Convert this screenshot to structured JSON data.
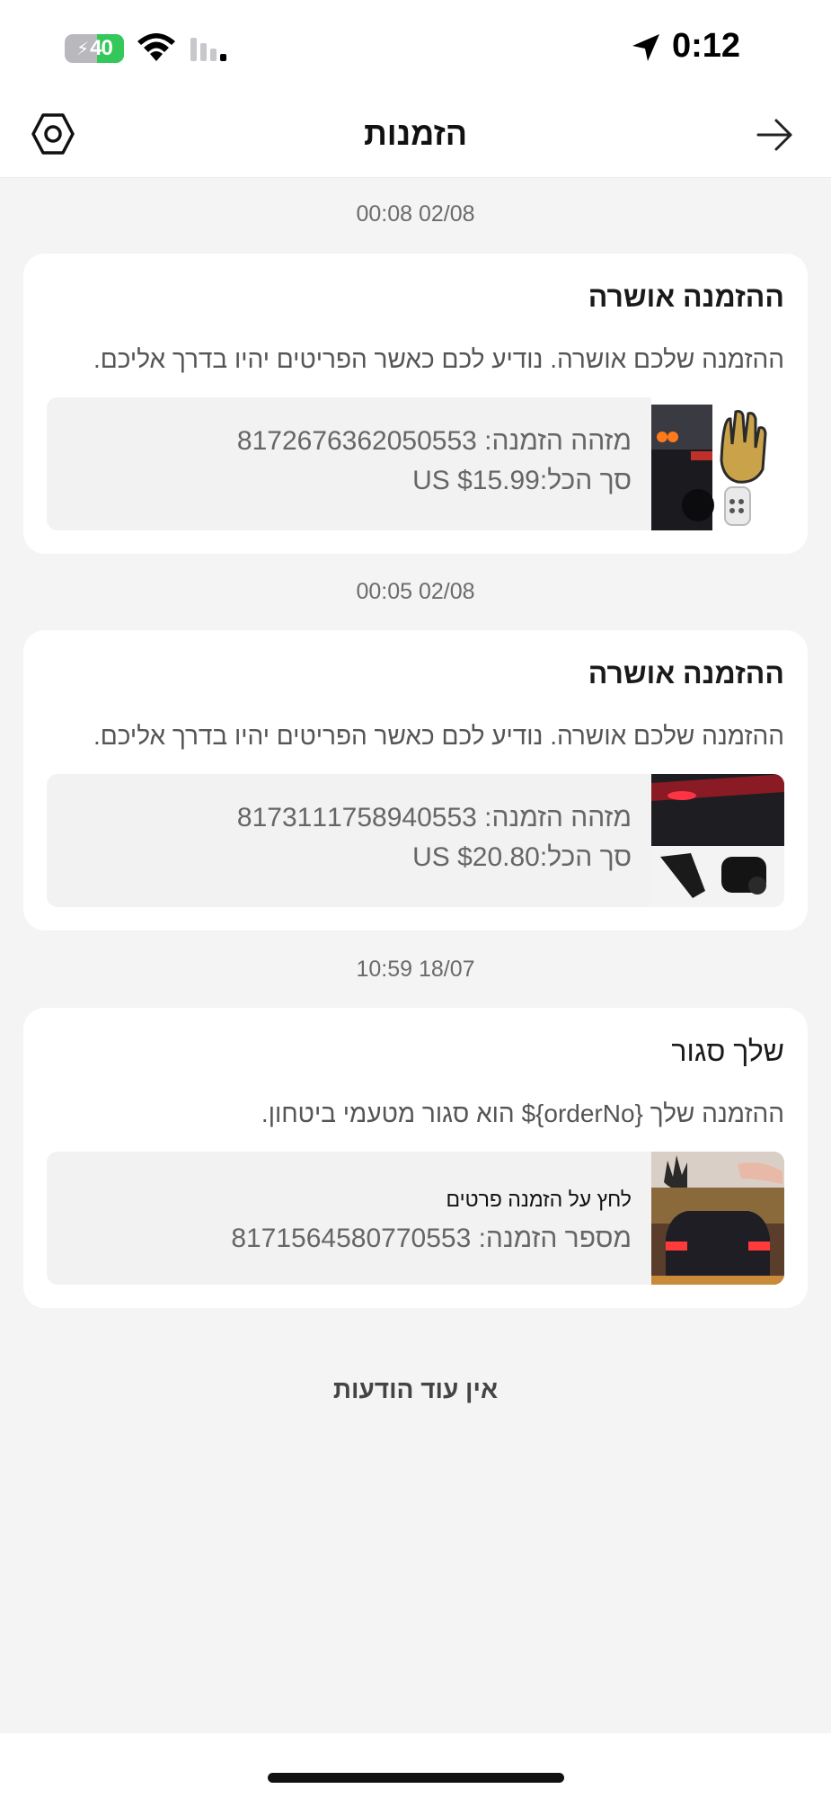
{
  "status_bar": {
    "battery": "40",
    "time": "0:12"
  },
  "header": {
    "title": "הזמנות",
    "settings_icon": "gear-icon",
    "back_icon": "arrow-right-icon"
  },
  "notifications": [
    {
      "timestamp": "00:08 02/08",
      "title": "ההזמנה אושרה",
      "description": "ההזמנה שלכם אושרה. נודיע לכם כאשר הפריטים יהיו בדרך אליכם.",
      "line1": "מזהה הזמנה: 8172676362050553",
      "line2": "סך הכל:US $15.99"
    },
    {
      "timestamp": "00:05 02/08",
      "title": "ההזמנה אושרה",
      "description": "ההזמנה שלכם אושרה. נודיע לכם כאשר הפריטים יהיו בדרך אליכם.",
      "line1": "מזהה הזמנה: 8173111758940553",
      "line2": "סך הכל:US $20.80"
    },
    {
      "timestamp": "10:59 18/07",
      "title": "שלך סגור",
      "description": "ההזמנה שלך {orderNo}$ הוא סגור מטעמי ביטחון.",
      "hint": "לחץ על הזמנה פרטים",
      "line2": "מספר הזמנה: 8171564580770553"
    }
  ],
  "footer_text": "אין עוד הודעות",
  "colors": {
    "background": "#f4f4f5",
    "card": "#ffffff",
    "battery_fill": "#34c759"
  }
}
